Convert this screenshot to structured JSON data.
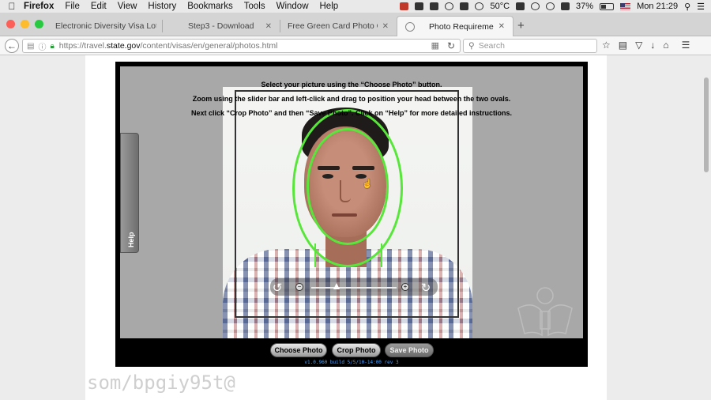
{
  "menubar": {
    "app": "Firefox",
    "items": [
      "File",
      "Edit",
      "View",
      "History",
      "Bookmarks",
      "Tools",
      "Window",
      "Help"
    ],
    "temperature": "50°C",
    "battery": "37%",
    "clock": "Mon 21:29"
  },
  "tabs": [
    {
      "label": "Electronic Diversity Visa Lottery",
      "close": "✕"
    },
    {
      "label": "Step3 - Download",
      "close": "✕"
    },
    {
      "label": "Free Green Card Photo Checke...",
      "close": "✕"
    },
    {
      "label": "Photo Requirements",
      "close": "✕"
    }
  ],
  "newtab": "+",
  "nav": {
    "url_prefix": "https://travel.",
    "url_domain": "state.gov",
    "url_path": "/content/visas/en/general/photos.html",
    "search_placeholder": "Search"
  },
  "tool": {
    "instruction_1": "Select your picture using the “Choose Photo” button.",
    "instruction_2": "Zoom using the slider bar and left-click and drag to position your head between the two ovals.",
    "instruction_3": "Next click “Crop Photo” and then “Save Photo”. Click on “Help” for more detailed instructions.",
    "help_label": "Help",
    "buttons": {
      "choose": "Choose Photo",
      "crop": "Crop Photo",
      "save": "Save Photo"
    },
    "build": "v1.0.960 build 5/5/10-14:00 rev 3",
    "zoom_level": 0.3
  },
  "background_text": "som/bpgiy95t@",
  "colors": {
    "oval": "#58e63a",
    "build_text": "#4aa0ff"
  }
}
